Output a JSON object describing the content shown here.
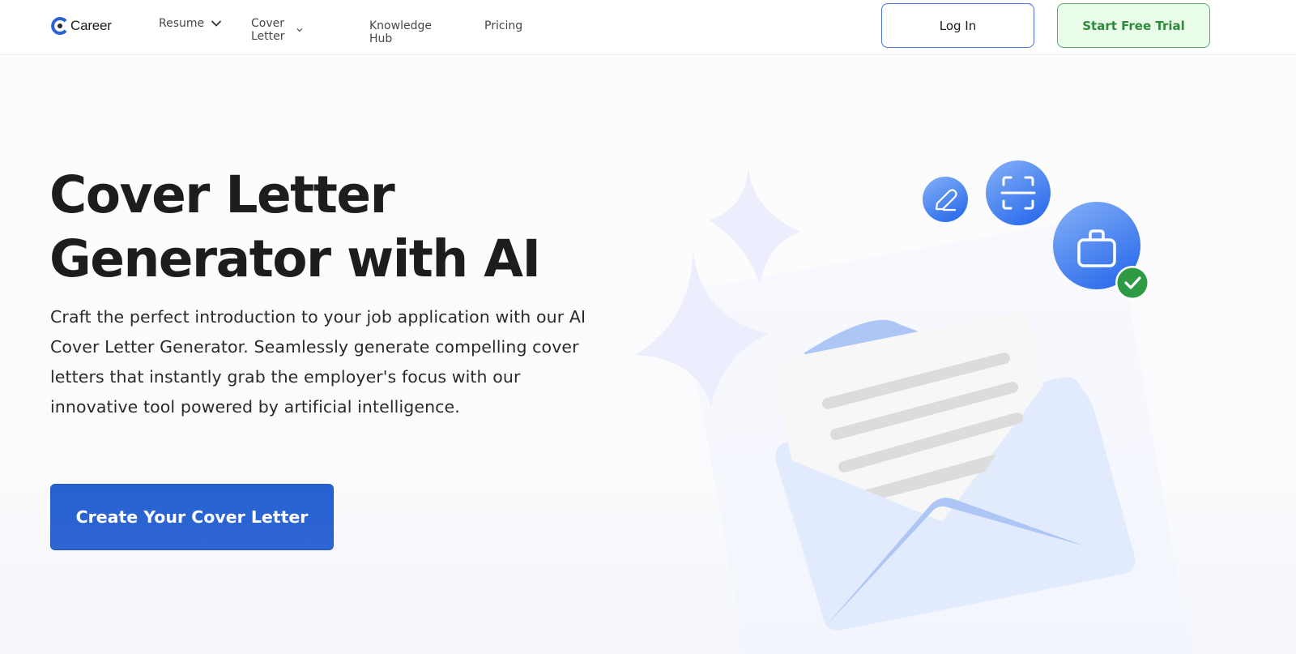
{
  "header": {
    "logo_text": "Career",
    "nav": [
      {
        "label": "Resume",
        "has_dropdown": true
      },
      {
        "label": "Cover Letter",
        "has_dropdown": true
      },
      {
        "label": "Knowledge Hub",
        "has_dropdown": false
      },
      {
        "label": "Pricing",
        "has_dropdown": false
      }
    ],
    "login_label": "Log In",
    "trial_label": "Start Free Trial"
  },
  "hero": {
    "title_line1": "Cover Letter",
    "title_line2": "Generator with AI",
    "description": "Craft the perfect introduction to your job application with our AI Cover Letter Generator. Seamlessly generate compelling cover letters that instantly grab the employer's focus with our innovative tool powered by artificial intelligence.",
    "cta_label": "Create Your Cover Letter"
  },
  "illustration": {
    "icons": [
      "pencil-icon",
      "scan-icon",
      "briefcase-icon",
      "checkmark-icon"
    ],
    "colors": {
      "icon_blue": "#3b7cf0",
      "check_green": "#2f9a44",
      "envelope": "#dfe9fd",
      "envelope_flap": "#aec6f5",
      "letter": "#f7f7f7",
      "letter_lines": "#dcdcdc",
      "sparkle": "#ecedfd"
    }
  },
  "colors": {
    "brand_blue": "#2761d1",
    "trial_green": "#2f8a3c",
    "trial_bg": "#e9fbe9"
  }
}
